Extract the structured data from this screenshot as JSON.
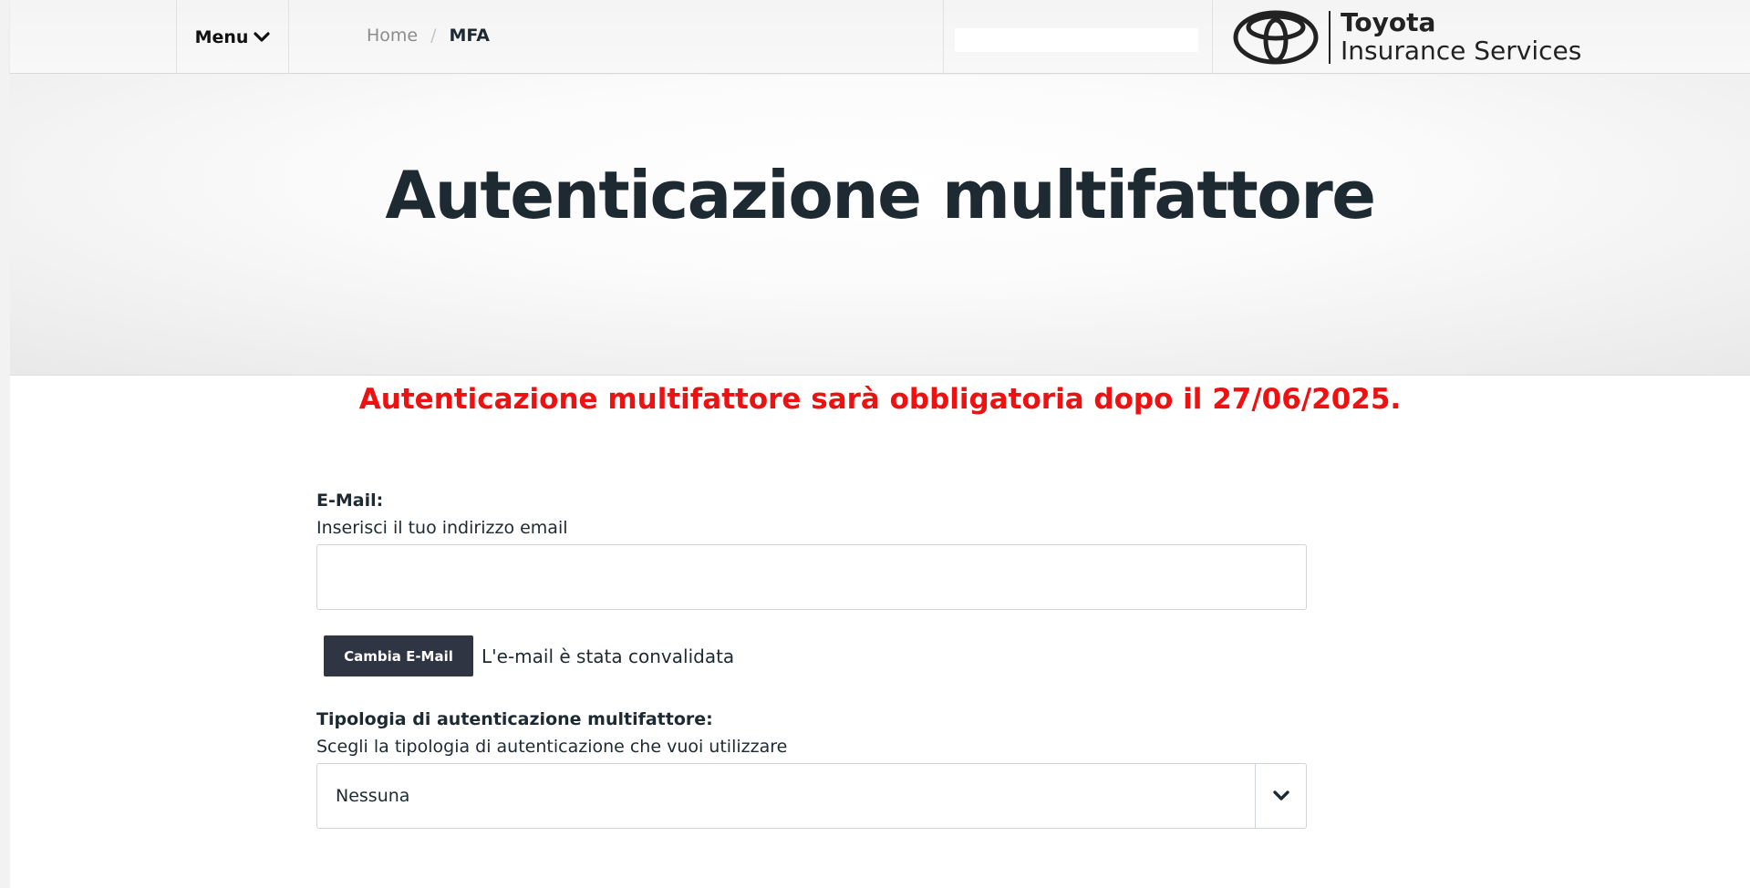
{
  "header": {
    "menu_label": "Menu",
    "breadcrumb": {
      "home": "Home",
      "separator": "/",
      "current": "MFA"
    },
    "search": {
      "value": ""
    },
    "logo": {
      "brand": "Toyota",
      "subtitle": "Insurance Services"
    }
  },
  "hero": {
    "title": "Autenticazione multifattore"
  },
  "notice": {
    "text": "Autenticazione multifattore sarà obbligatoria dopo il 27/06/2025.",
    "color": "#ee1111"
  },
  "form": {
    "email": {
      "label": "E-Mail:",
      "help": "Inserisci il tuo indirizzo email",
      "value": "",
      "change_button": "Cambia E-Mail",
      "status": "L'e-mail è stata convalidata"
    },
    "mfa_type": {
      "label": "Tipologia di autenticazione multifattore:",
      "help": "Scegli la tipologia di autenticazione che vuoi utilizzare",
      "selected": "Nessuna"
    }
  },
  "colors": {
    "button_bg": "#2f3542",
    "text": "#1e2a32"
  },
  "icons": {
    "menu": "chevron-down-icon",
    "select": "chevron-down-icon",
    "logo": "toyota-emblem-icon"
  }
}
